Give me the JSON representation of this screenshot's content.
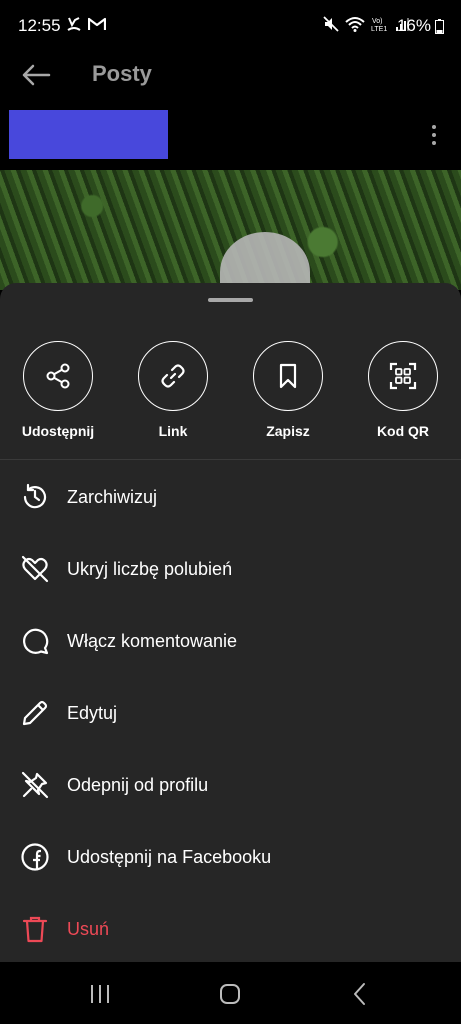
{
  "status_bar": {
    "time": "12:55",
    "battery_percent": "16%",
    "left_icons": [
      "missed-call-icon",
      "gmail-icon"
    ],
    "right_icons": [
      "mute-icon",
      "wifi-icon",
      "volte-icon",
      "signal-icon",
      "battery-icon"
    ],
    "volte_label": "Vo) LTE1"
  },
  "top_bar": {
    "title": "Posty",
    "back_icon": "back-arrow-icon"
  },
  "post": {
    "more_icon": "more-vertical-icon",
    "username_redacted_color": "#4848dc"
  },
  "actions": [
    {
      "label": "Udostępnij",
      "icon": "share-icon"
    },
    {
      "label": "Link",
      "icon": "link-icon"
    },
    {
      "label": "Zapisz",
      "icon": "bookmark-icon"
    },
    {
      "label": "Kod QR",
      "icon": "qr-code-icon"
    }
  ],
  "menu": [
    {
      "label": "Zarchiwizuj",
      "icon": "archive-history-icon"
    },
    {
      "label": "Ukryj liczbę polubień",
      "icon": "heart-off-icon"
    },
    {
      "label": "Włącz komentowanie",
      "icon": "comment-icon"
    },
    {
      "label": "Edytuj",
      "icon": "pencil-icon"
    },
    {
      "label": "Odepnij od profilu",
      "icon": "unpin-icon"
    },
    {
      "label": "Udostępnij na Facebooku",
      "icon": "facebook-icon"
    },
    {
      "label": "Usuń",
      "icon": "trash-icon",
      "danger": true
    }
  ],
  "nav_bar": {
    "icons": [
      "recent-apps-icon",
      "home-icon",
      "nav-back-icon"
    ]
  },
  "colors": {
    "sheet_bg": "#262626",
    "danger": "#ed4956",
    "text": "#ffffff"
  }
}
